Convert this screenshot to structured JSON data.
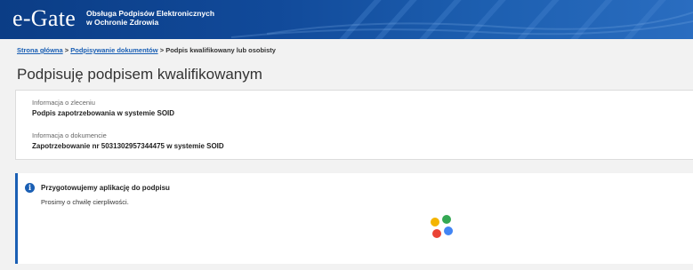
{
  "header": {
    "logo": "e-Gate",
    "subtitle_line1": "Obsługa Podpisów Elektronicznych",
    "subtitle_line2": "w Ochronie Zdrowia",
    "colors": {
      "background": "#0b3d86",
      "text": "#ffffff"
    }
  },
  "breadcrumb": {
    "items": [
      {
        "label": "Strona główna"
      },
      {
        "label": "Podpisywanie dokumentów"
      },
      {
        "label": "Podpis kwalifikowany lub osobisty"
      }
    ],
    "separator": ">"
  },
  "page": {
    "title": "Podpisuję podpisem kwalifikowanym"
  },
  "info": {
    "order_label": "Informacja o zleceniu",
    "order_value": "Podpis zapotrzebowania w systemie SOID",
    "document_label": "Informacja o dokumencie",
    "document_value": "Zapotrzebowanie nr 5031302957344475 w systemie SOID"
  },
  "status": {
    "icon": "info-icon",
    "icon_glyph": "i",
    "title": "Przygotowujemy aplikację do podpisu",
    "message": "Prosimy o chwilę cierpliwości.",
    "accent_color": "#1a5fb4",
    "spinner_colors": [
      "#f4b400",
      "#34a853",
      "#ea4335",
      "#4285f4"
    ]
  }
}
